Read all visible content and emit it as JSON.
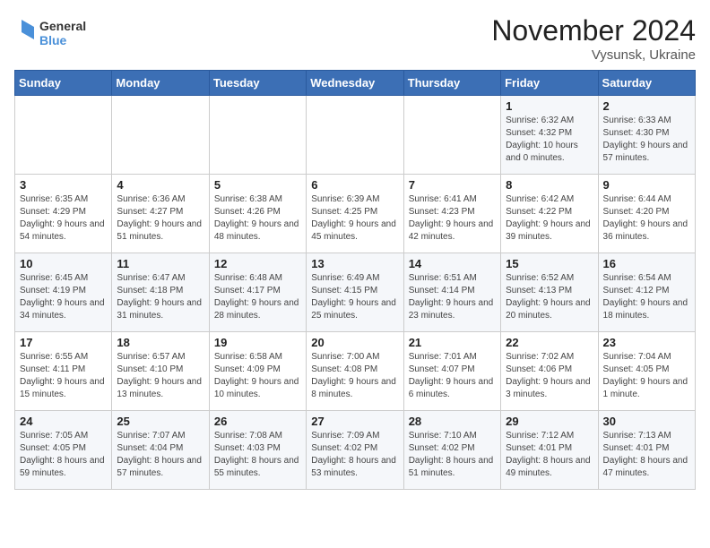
{
  "logo": {
    "line1": "General",
    "line2": "Blue"
  },
  "title": "November 2024",
  "subtitle": "Vysunsk, Ukraine",
  "days_of_week": [
    "Sunday",
    "Monday",
    "Tuesday",
    "Wednesday",
    "Thursday",
    "Friday",
    "Saturday"
  ],
  "weeks": [
    [
      {
        "day": "",
        "info": ""
      },
      {
        "day": "",
        "info": ""
      },
      {
        "day": "",
        "info": ""
      },
      {
        "day": "",
        "info": ""
      },
      {
        "day": "",
        "info": ""
      },
      {
        "day": "1",
        "info": "Sunrise: 6:32 AM\nSunset: 4:32 PM\nDaylight: 10 hours\nand 0 minutes."
      },
      {
        "day": "2",
        "info": "Sunrise: 6:33 AM\nSunset: 4:30 PM\nDaylight: 9 hours\nand 57 minutes."
      }
    ],
    [
      {
        "day": "3",
        "info": "Sunrise: 6:35 AM\nSunset: 4:29 PM\nDaylight: 9 hours\nand 54 minutes."
      },
      {
        "day": "4",
        "info": "Sunrise: 6:36 AM\nSunset: 4:27 PM\nDaylight: 9 hours\nand 51 minutes."
      },
      {
        "day": "5",
        "info": "Sunrise: 6:38 AM\nSunset: 4:26 PM\nDaylight: 9 hours\nand 48 minutes."
      },
      {
        "day": "6",
        "info": "Sunrise: 6:39 AM\nSunset: 4:25 PM\nDaylight: 9 hours\nand 45 minutes."
      },
      {
        "day": "7",
        "info": "Sunrise: 6:41 AM\nSunset: 4:23 PM\nDaylight: 9 hours\nand 42 minutes."
      },
      {
        "day": "8",
        "info": "Sunrise: 6:42 AM\nSunset: 4:22 PM\nDaylight: 9 hours\nand 39 minutes."
      },
      {
        "day": "9",
        "info": "Sunrise: 6:44 AM\nSunset: 4:20 PM\nDaylight: 9 hours\nand 36 minutes."
      }
    ],
    [
      {
        "day": "10",
        "info": "Sunrise: 6:45 AM\nSunset: 4:19 PM\nDaylight: 9 hours\nand 34 minutes."
      },
      {
        "day": "11",
        "info": "Sunrise: 6:47 AM\nSunset: 4:18 PM\nDaylight: 9 hours\nand 31 minutes."
      },
      {
        "day": "12",
        "info": "Sunrise: 6:48 AM\nSunset: 4:17 PM\nDaylight: 9 hours\nand 28 minutes."
      },
      {
        "day": "13",
        "info": "Sunrise: 6:49 AM\nSunset: 4:15 PM\nDaylight: 9 hours\nand 25 minutes."
      },
      {
        "day": "14",
        "info": "Sunrise: 6:51 AM\nSunset: 4:14 PM\nDaylight: 9 hours\nand 23 minutes."
      },
      {
        "day": "15",
        "info": "Sunrise: 6:52 AM\nSunset: 4:13 PM\nDaylight: 9 hours\nand 20 minutes."
      },
      {
        "day": "16",
        "info": "Sunrise: 6:54 AM\nSunset: 4:12 PM\nDaylight: 9 hours\nand 18 minutes."
      }
    ],
    [
      {
        "day": "17",
        "info": "Sunrise: 6:55 AM\nSunset: 4:11 PM\nDaylight: 9 hours\nand 15 minutes."
      },
      {
        "day": "18",
        "info": "Sunrise: 6:57 AM\nSunset: 4:10 PM\nDaylight: 9 hours\nand 13 minutes."
      },
      {
        "day": "19",
        "info": "Sunrise: 6:58 AM\nSunset: 4:09 PM\nDaylight: 9 hours\nand 10 minutes."
      },
      {
        "day": "20",
        "info": "Sunrise: 7:00 AM\nSunset: 4:08 PM\nDaylight: 9 hours\nand 8 minutes."
      },
      {
        "day": "21",
        "info": "Sunrise: 7:01 AM\nSunset: 4:07 PM\nDaylight: 9 hours\nand 6 minutes."
      },
      {
        "day": "22",
        "info": "Sunrise: 7:02 AM\nSunset: 4:06 PM\nDaylight: 9 hours\nand 3 minutes."
      },
      {
        "day": "23",
        "info": "Sunrise: 7:04 AM\nSunset: 4:05 PM\nDaylight: 9 hours\nand 1 minute."
      }
    ],
    [
      {
        "day": "24",
        "info": "Sunrise: 7:05 AM\nSunset: 4:05 PM\nDaylight: 8 hours\nand 59 minutes."
      },
      {
        "day": "25",
        "info": "Sunrise: 7:07 AM\nSunset: 4:04 PM\nDaylight: 8 hours\nand 57 minutes."
      },
      {
        "day": "26",
        "info": "Sunrise: 7:08 AM\nSunset: 4:03 PM\nDaylight: 8 hours\nand 55 minutes."
      },
      {
        "day": "27",
        "info": "Sunrise: 7:09 AM\nSunset: 4:02 PM\nDaylight: 8 hours\nand 53 minutes."
      },
      {
        "day": "28",
        "info": "Sunrise: 7:10 AM\nSunset: 4:02 PM\nDaylight: 8 hours\nand 51 minutes."
      },
      {
        "day": "29",
        "info": "Sunrise: 7:12 AM\nSunset: 4:01 PM\nDaylight: 8 hours\nand 49 minutes."
      },
      {
        "day": "30",
        "info": "Sunrise: 7:13 AM\nSunset: 4:01 PM\nDaylight: 8 hours\nand 47 minutes."
      }
    ]
  ]
}
